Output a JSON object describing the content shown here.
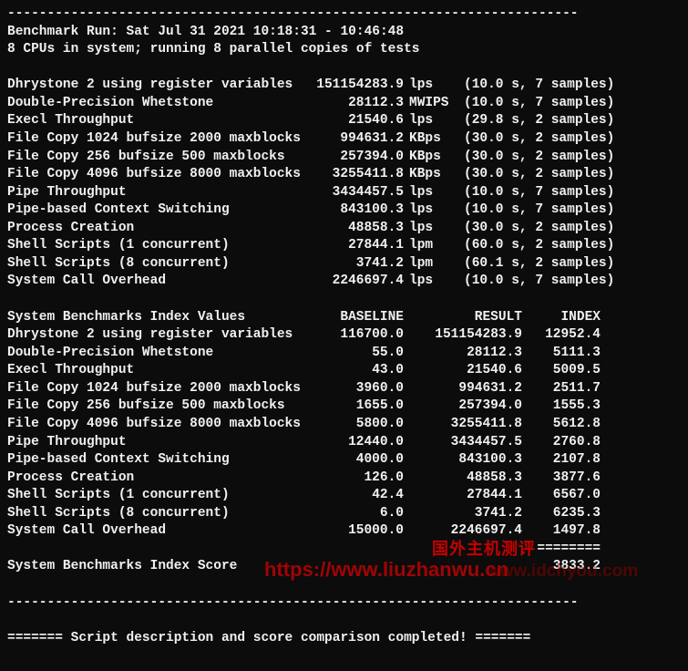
{
  "header": {
    "divider_top": "------------------------------------------------------------------------",
    "run_line": "Benchmark Run: Sat Jul 31 2021 10:18:31 - 10:46:48",
    "cpu_line": "8 CPUs in system; running 8 parallel copies of tests"
  },
  "tests": [
    {
      "name": "Dhrystone 2 using register variables",
      "value": "151154283.9",
      "unit": "lps",
      "detail": "(10.0 s, 7 samples)"
    },
    {
      "name": "Double-Precision Whetstone",
      "value": "28112.3",
      "unit": "MWIPS",
      "detail": "(10.0 s, 7 samples)"
    },
    {
      "name": "Execl Throughput",
      "value": "21540.6",
      "unit": "lps",
      "detail": "(29.8 s, 2 samples)"
    },
    {
      "name": "File Copy 1024 bufsize 2000 maxblocks",
      "value": "994631.2",
      "unit": "KBps",
      "detail": "(30.0 s, 2 samples)"
    },
    {
      "name": "File Copy 256 bufsize 500 maxblocks",
      "value": "257394.0",
      "unit": "KBps",
      "detail": "(30.0 s, 2 samples)"
    },
    {
      "name": "File Copy 4096 bufsize 8000 maxblocks",
      "value": "3255411.8",
      "unit": "KBps",
      "detail": "(30.0 s, 2 samples)"
    },
    {
      "name": "Pipe Throughput",
      "value": "3434457.5",
      "unit": "lps",
      "detail": "(10.0 s, 7 samples)"
    },
    {
      "name": "Pipe-based Context Switching",
      "value": "843100.3",
      "unit": "lps",
      "detail": "(10.0 s, 7 samples)"
    },
    {
      "name": "Process Creation",
      "value": "48858.3",
      "unit": "lps",
      "detail": "(30.0 s, 2 samples)"
    },
    {
      "name": "Shell Scripts (1 concurrent)",
      "value": "27844.1",
      "unit": "lpm",
      "detail": "(60.0 s, 2 samples)"
    },
    {
      "name": "Shell Scripts (8 concurrent)",
      "value": "3741.2",
      "unit": "lpm",
      "detail": "(60.1 s, 2 samples)"
    },
    {
      "name": "System Call Overhead",
      "value": "2246697.4",
      "unit": "lps",
      "detail": "(10.0 s, 7 samples)"
    }
  ],
  "index_header": {
    "name": "System Benchmarks Index Values",
    "baseline": "BASELINE",
    "result": "RESULT",
    "index": "INDEX"
  },
  "index_rows": [
    {
      "name": "Dhrystone 2 using register variables",
      "baseline": "116700.0",
      "result": "151154283.9",
      "index": "12952.4"
    },
    {
      "name": "Double-Precision Whetstone",
      "baseline": "55.0",
      "result": "28112.3",
      "index": "5111.3"
    },
    {
      "name": "Execl Throughput",
      "baseline": "43.0",
      "result": "21540.6",
      "index": "5009.5"
    },
    {
      "name": "File Copy 1024 bufsize 2000 maxblocks",
      "baseline": "3960.0",
      "result": "994631.2",
      "index": "2511.7"
    },
    {
      "name": "File Copy 256 bufsize 500 maxblocks",
      "baseline": "1655.0",
      "result": "257394.0",
      "index": "1555.3"
    },
    {
      "name": "File Copy 4096 bufsize 8000 maxblocks",
      "baseline": "5800.0",
      "result": "3255411.8",
      "index": "5612.8"
    },
    {
      "name": "Pipe Throughput",
      "baseline": "12440.0",
      "result": "3434457.5",
      "index": "2760.8"
    },
    {
      "name": "Pipe-based Context Switching",
      "baseline": "4000.0",
      "result": "843100.3",
      "index": "2107.8"
    },
    {
      "name": "Process Creation",
      "baseline": "126.0",
      "result": "48858.3",
      "index": "3877.6"
    },
    {
      "name": "Shell Scripts (1 concurrent)",
      "baseline": "42.4",
      "result": "27844.1",
      "index": "6567.0"
    },
    {
      "name": "Shell Scripts (8 concurrent)",
      "baseline": "6.0",
      "result": "3741.2",
      "index": "6235.3"
    },
    {
      "name": "System Call Overhead",
      "baseline": "15000.0",
      "result": "2246697.4",
      "index": "1497.8"
    }
  ],
  "score": {
    "underline": "========",
    "label": "System Benchmarks Index Score",
    "value": "3833.2"
  },
  "footer": {
    "divider": "------------------------------------------------------------------------",
    "line": "======= Script description and score comparison completed! ======="
  },
  "watermarks": {
    "cn": "国外主机测评",
    "url": "https://www.liuzhanwu.cn",
    "url2": "www.idchyou.com"
  }
}
